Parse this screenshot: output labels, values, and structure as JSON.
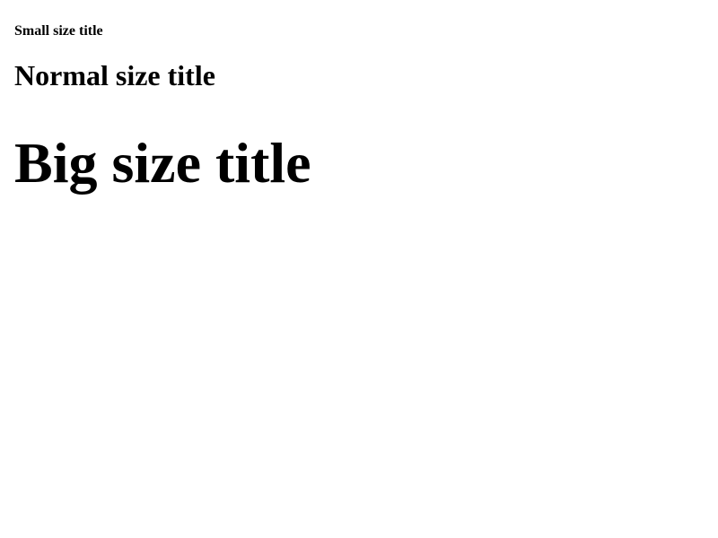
{
  "titles": {
    "small": "Small size title",
    "normal": "Normal size title",
    "big": "Big size title"
  },
  "colors": {
    "background": "#ffffff",
    "text": "#000000"
  }
}
